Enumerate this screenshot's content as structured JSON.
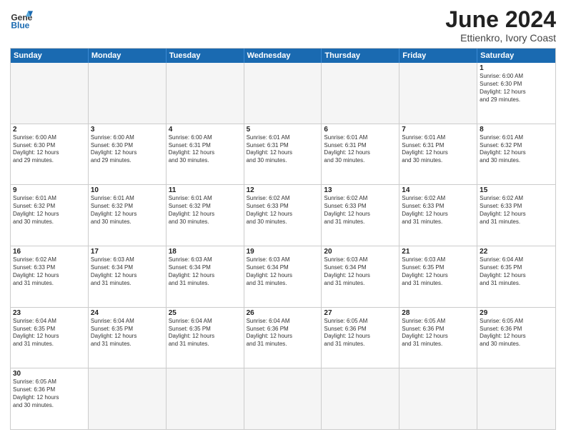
{
  "header": {
    "logo_general": "General",
    "logo_blue": "Blue",
    "month_year": "June 2024",
    "location": "Ettienkro, Ivory Coast"
  },
  "days_of_week": [
    "Sunday",
    "Monday",
    "Tuesday",
    "Wednesday",
    "Thursday",
    "Friday",
    "Saturday"
  ],
  "rows": [
    [
      {
        "day": "",
        "info": "",
        "empty": true
      },
      {
        "day": "",
        "info": "",
        "empty": true
      },
      {
        "day": "",
        "info": "",
        "empty": true
      },
      {
        "day": "",
        "info": "",
        "empty": true
      },
      {
        "day": "",
        "info": "",
        "empty": true
      },
      {
        "day": "",
        "info": "",
        "empty": true
      },
      {
        "day": "1",
        "info": "Sunrise: 6:00 AM\nSunset: 6:30 PM\nDaylight: 12 hours\nand 29 minutes.",
        "empty": false
      }
    ],
    [
      {
        "day": "2",
        "info": "Sunrise: 6:00 AM\nSunset: 6:30 PM\nDaylight: 12 hours\nand 29 minutes.",
        "empty": false
      },
      {
        "day": "3",
        "info": "Sunrise: 6:00 AM\nSunset: 6:30 PM\nDaylight: 12 hours\nand 29 minutes.",
        "empty": false
      },
      {
        "day": "4",
        "info": "Sunrise: 6:00 AM\nSunset: 6:31 PM\nDaylight: 12 hours\nand 30 minutes.",
        "empty": false
      },
      {
        "day": "5",
        "info": "Sunrise: 6:01 AM\nSunset: 6:31 PM\nDaylight: 12 hours\nand 30 minutes.",
        "empty": false
      },
      {
        "day": "6",
        "info": "Sunrise: 6:01 AM\nSunset: 6:31 PM\nDaylight: 12 hours\nand 30 minutes.",
        "empty": false
      },
      {
        "day": "7",
        "info": "Sunrise: 6:01 AM\nSunset: 6:31 PM\nDaylight: 12 hours\nand 30 minutes.",
        "empty": false
      },
      {
        "day": "8",
        "info": "Sunrise: 6:01 AM\nSunset: 6:32 PM\nDaylight: 12 hours\nand 30 minutes.",
        "empty": false
      }
    ],
    [
      {
        "day": "9",
        "info": "Sunrise: 6:01 AM\nSunset: 6:32 PM\nDaylight: 12 hours\nand 30 minutes.",
        "empty": false
      },
      {
        "day": "10",
        "info": "Sunrise: 6:01 AM\nSunset: 6:32 PM\nDaylight: 12 hours\nand 30 minutes.",
        "empty": false
      },
      {
        "day": "11",
        "info": "Sunrise: 6:01 AM\nSunset: 6:32 PM\nDaylight: 12 hours\nand 30 minutes.",
        "empty": false
      },
      {
        "day": "12",
        "info": "Sunrise: 6:02 AM\nSunset: 6:33 PM\nDaylight: 12 hours\nand 30 minutes.",
        "empty": false
      },
      {
        "day": "13",
        "info": "Sunrise: 6:02 AM\nSunset: 6:33 PM\nDaylight: 12 hours\nand 31 minutes.",
        "empty": false
      },
      {
        "day": "14",
        "info": "Sunrise: 6:02 AM\nSunset: 6:33 PM\nDaylight: 12 hours\nand 31 minutes.",
        "empty": false
      },
      {
        "day": "15",
        "info": "Sunrise: 6:02 AM\nSunset: 6:33 PM\nDaylight: 12 hours\nand 31 minutes.",
        "empty": false
      }
    ],
    [
      {
        "day": "16",
        "info": "Sunrise: 6:02 AM\nSunset: 6:33 PM\nDaylight: 12 hours\nand 31 minutes.",
        "empty": false
      },
      {
        "day": "17",
        "info": "Sunrise: 6:03 AM\nSunset: 6:34 PM\nDaylight: 12 hours\nand 31 minutes.",
        "empty": false
      },
      {
        "day": "18",
        "info": "Sunrise: 6:03 AM\nSunset: 6:34 PM\nDaylight: 12 hours\nand 31 minutes.",
        "empty": false
      },
      {
        "day": "19",
        "info": "Sunrise: 6:03 AM\nSunset: 6:34 PM\nDaylight: 12 hours\nand 31 minutes.",
        "empty": false
      },
      {
        "day": "20",
        "info": "Sunrise: 6:03 AM\nSunset: 6:34 PM\nDaylight: 12 hours\nand 31 minutes.",
        "empty": false
      },
      {
        "day": "21",
        "info": "Sunrise: 6:03 AM\nSunset: 6:35 PM\nDaylight: 12 hours\nand 31 minutes.",
        "empty": false
      },
      {
        "day": "22",
        "info": "Sunrise: 6:04 AM\nSunset: 6:35 PM\nDaylight: 12 hours\nand 31 minutes.",
        "empty": false
      }
    ],
    [
      {
        "day": "23",
        "info": "Sunrise: 6:04 AM\nSunset: 6:35 PM\nDaylight: 12 hours\nand 31 minutes.",
        "empty": false
      },
      {
        "day": "24",
        "info": "Sunrise: 6:04 AM\nSunset: 6:35 PM\nDaylight: 12 hours\nand 31 minutes.",
        "empty": false
      },
      {
        "day": "25",
        "info": "Sunrise: 6:04 AM\nSunset: 6:35 PM\nDaylight: 12 hours\nand 31 minutes.",
        "empty": false
      },
      {
        "day": "26",
        "info": "Sunrise: 6:04 AM\nSunset: 6:36 PM\nDaylight: 12 hours\nand 31 minutes.",
        "empty": false
      },
      {
        "day": "27",
        "info": "Sunrise: 6:05 AM\nSunset: 6:36 PM\nDaylight: 12 hours\nand 31 minutes.",
        "empty": false
      },
      {
        "day": "28",
        "info": "Sunrise: 6:05 AM\nSunset: 6:36 PM\nDaylight: 12 hours\nand 31 minutes.",
        "empty": false
      },
      {
        "day": "29",
        "info": "Sunrise: 6:05 AM\nSunset: 6:36 PM\nDaylight: 12 hours\nand 30 minutes.",
        "empty": false
      }
    ],
    [
      {
        "day": "30",
        "info": "Sunrise: 6:05 AM\nSunset: 6:36 PM\nDaylight: 12 hours\nand 30 minutes.",
        "empty": false
      },
      {
        "day": "",
        "info": "",
        "empty": true
      },
      {
        "day": "",
        "info": "",
        "empty": true
      },
      {
        "day": "",
        "info": "",
        "empty": true
      },
      {
        "day": "",
        "info": "",
        "empty": true
      },
      {
        "day": "",
        "info": "",
        "empty": true
      },
      {
        "day": "",
        "info": "",
        "empty": true
      }
    ]
  ]
}
